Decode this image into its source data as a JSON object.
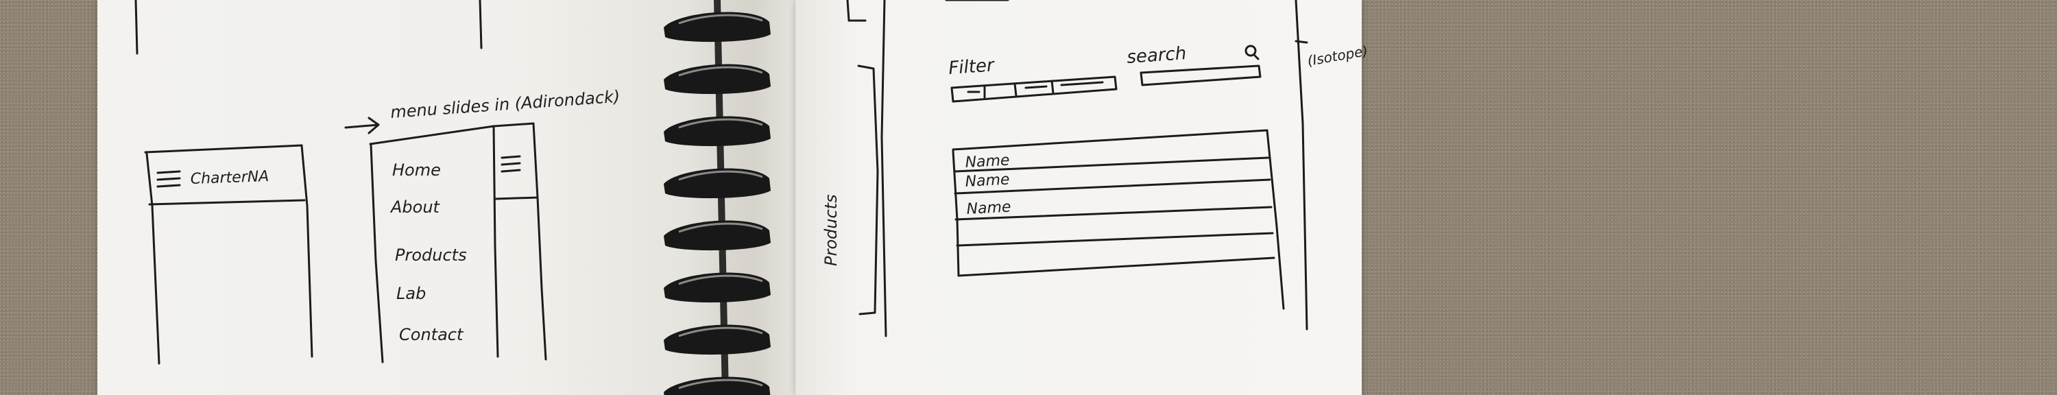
{
  "left_page": {
    "annotation": "menu slides in (Adirondack)",
    "sketch1": {
      "brand": "CharterNA"
    },
    "sketch2": {
      "menu_items": [
        "Home",
        "About",
        "Products",
        "Lab",
        "Contact"
      ]
    }
  },
  "right_page": {
    "side_label": "Products",
    "filter_label": "Filter",
    "search_label": "search",
    "list_rows": [
      "Name",
      "Name",
      "Name"
    ],
    "margin_note": "(Isotope)"
  }
}
